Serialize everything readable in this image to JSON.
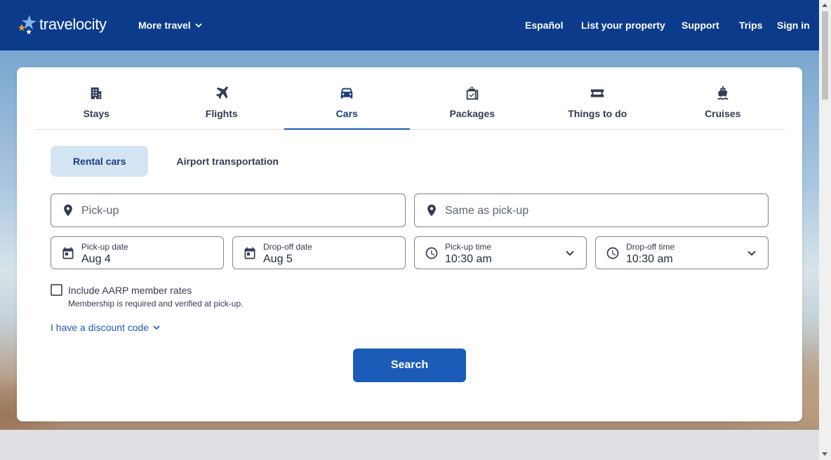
{
  "header": {
    "logo_text": "travelocity",
    "more_travel": "More travel",
    "nav": [
      "Español",
      "List your property",
      "Support",
      "Trips",
      "Sign in"
    ],
    "colors": {
      "header_bg": "#0d3b8c",
      "primary": "#1b5cb8"
    }
  },
  "tabs": [
    {
      "label": "Stays",
      "icon": "building-icon"
    },
    {
      "label": "Flights",
      "icon": "airplane-icon"
    },
    {
      "label": "Cars",
      "icon": "car-icon",
      "active": true
    },
    {
      "label": "Packages",
      "icon": "luggage-icon"
    },
    {
      "label": "Things to do",
      "icon": "ticket-icon"
    },
    {
      "label": "Cruises",
      "icon": "ship-icon"
    }
  ],
  "subtabs": {
    "rental": "Rental cars",
    "airport": "Airport transportation"
  },
  "form": {
    "pickup_placeholder": "Pick-up",
    "dropoff_placeholder": "Same as pick-up",
    "pickup_date_label": "Pick-up date",
    "pickup_date_value": "Aug 4",
    "dropoff_date_label": "Drop-off date",
    "dropoff_date_value": "Aug 5",
    "pickup_time_label": "Pick-up time",
    "pickup_time_value": "10:30 am",
    "dropoff_time_label": "Drop-off time",
    "dropoff_time_value": "10:30 am",
    "aarp_label": "Include AARP member rates",
    "aarp_sub": "Membership is required and verified at pick-up.",
    "discount": "I have a discount code",
    "search": "Search"
  }
}
